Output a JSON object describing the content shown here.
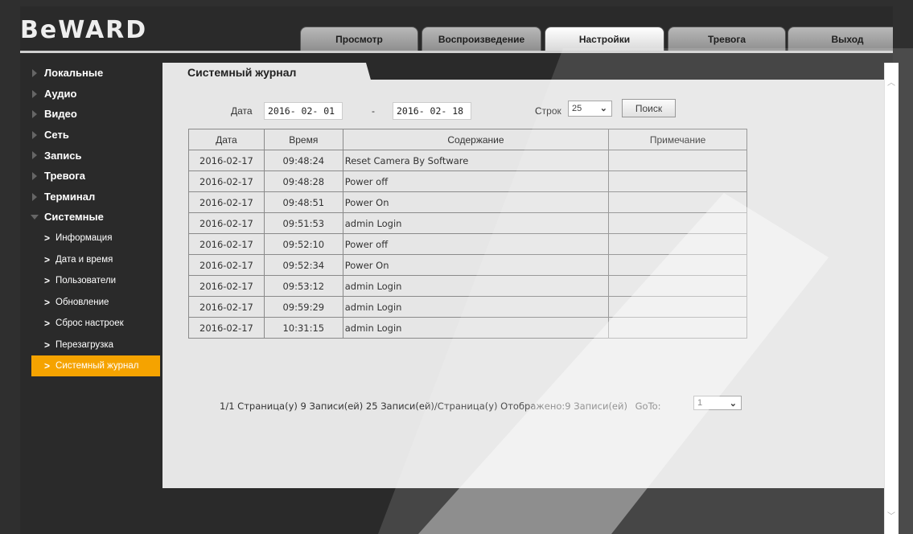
{
  "brand": {
    "logo": "BeWARD"
  },
  "tabs": [
    {
      "label": "Просмотр"
    },
    {
      "label": "Воспроизведение"
    },
    {
      "label": "Настройки"
    },
    {
      "label": "Тревога"
    },
    {
      "label": "Выход"
    }
  ],
  "active_tab": "Настройки",
  "sidebar": {
    "sections": [
      {
        "label": "Локальные"
      },
      {
        "label": "Аудио"
      },
      {
        "label": "Видео"
      },
      {
        "label": "Сеть"
      },
      {
        "label": "Запись"
      },
      {
        "label": "Тревога"
      },
      {
        "label": "Терминал"
      },
      {
        "label": "Системные"
      }
    ],
    "sub_items": [
      {
        "label": "Информация"
      },
      {
        "label": "Дата и время"
      },
      {
        "label": "Пользователи"
      },
      {
        "label": "Обновление"
      },
      {
        "label": "Сброс настроек"
      },
      {
        "label": "Перезагрузка"
      },
      {
        "label": "Системный журнал"
      }
    ]
  },
  "page": {
    "title": "Системный журнал"
  },
  "filter": {
    "date_label": "Дата",
    "date_from": "2016- 02- 01",
    "dash": "-",
    "date_to": "2016- 02- 18",
    "rows_label": "Строк",
    "rows_value": "25",
    "search_button": "Поиск"
  },
  "table": {
    "headers": [
      "Дата",
      "Время",
      "Содержание",
      "Примечание"
    ],
    "rows": [
      [
        "2016-02-17",
        "09:48:24",
        "Reset Camera By Software",
        ""
      ],
      [
        "2016-02-17",
        "09:48:28",
        "Power off",
        ""
      ],
      [
        "2016-02-17",
        "09:48:51",
        "Power On",
        ""
      ],
      [
        "2016-02-17",
        "09:51:53",
        "admin Login",
        ""
      ],
      [
        "2016-02-17",
        "09:52:10",
        "Power off",
        ""
      ],
      [
        "2016-02-17",
        "09:52:34",
        "Power On",
        ""
      ],
      [
        "2016-02-17",
        "09:53:12",
        "admin Login",
        ""
      ],
      [
        "2016-02-17",
        "09:59:29",
        "admin Login",
        ""
      ],
      [
        "2016-02-17",
        "10:31:15",
        "admin Login",
        ""
      ]
    ]
  },
  "pager": {
    "summary": "1/1 Страница(у) 9 Записи(ей) 25 Записи(ей)/Страница(у) Отображено:9 Записи(ей)",
    "goto_label": "GoTo:",
    "goto_value": "1"
  },
  "icons": {
    "collapsed_arrow": "triangle-right-icon",
    "expanded_arrow": "triangle-down-icon",
    "sub_arrow": "chevron-right-icon",
    "select_arrow": "chevron-down-icon"
  },
  "colors": {
    "accent": "#f5a300",
    "background": "#2f2f2f",
    "content": "#e6e6e6"
  }
}
